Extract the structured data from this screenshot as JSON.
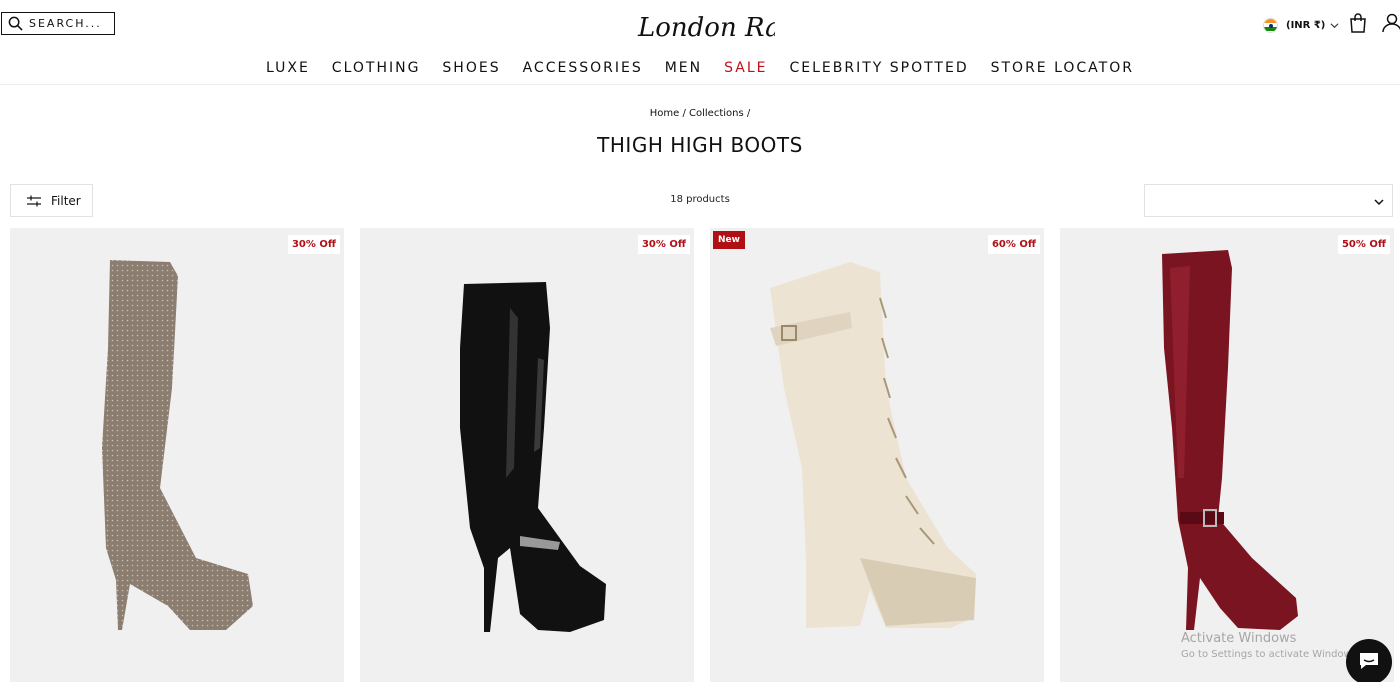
{
  "header": {
    "search_label": "SEARCH...",
    "logo_text": "London Rag",
    "currency_label": "(INR ₹)",
    "icons": [
      "search-icon",
      "india-flag-icon",
      "chevron-down-icon",
      "shopping-bag-icon",
      "user-icon"
    ]
  },
  "nav": {
    "items": [
      "LUXE",
      "CLOTHING",
      "SHOES",
      "ACCESSORIES",
      "MEN",
      "SALE",
      "CELEBRITY SPOTTED",
      "STORE LOCATOR"
    ],
    "highlight_color": "#c0111a"
  },
  "breadcrumb": {
    "home": "Home",
    "sep1": "/",
    "collections": "Collections",
    "sep2": "/"
  },
  "page": {
    "title": "THIGH HIGH BOOTS"
  },
  "toolbar": {
    "filter_label": "Filter",
    "product_count": "18 products",
    "sort_value": ""
  },
  "products": [
    {
      "badge": "30% Off",
      "badge_type": "discount",
      "color": "#8b7d6f"
    },
    {
      "badge": "30% Off",
      "badge_type": "discount",
      "color": "#111111"
    },
    {
      "badge": "New",
      "badge_type": "new",
      "badge2": "60% Off",
      "color": "#ece3d3"
    },
    {
      "badge": "50% Off",
      "badge_type": "discount",
      "color": "#7a1420"
    }
  ],
  "watermark": {
    "line1": "Activate Windows",
    "line2": "Go to Settings to activate Windows."
  },
  "colors": {
    "accent_red": "#b10f14",
    "card_bg": "#f0f0f0"
  }
}
